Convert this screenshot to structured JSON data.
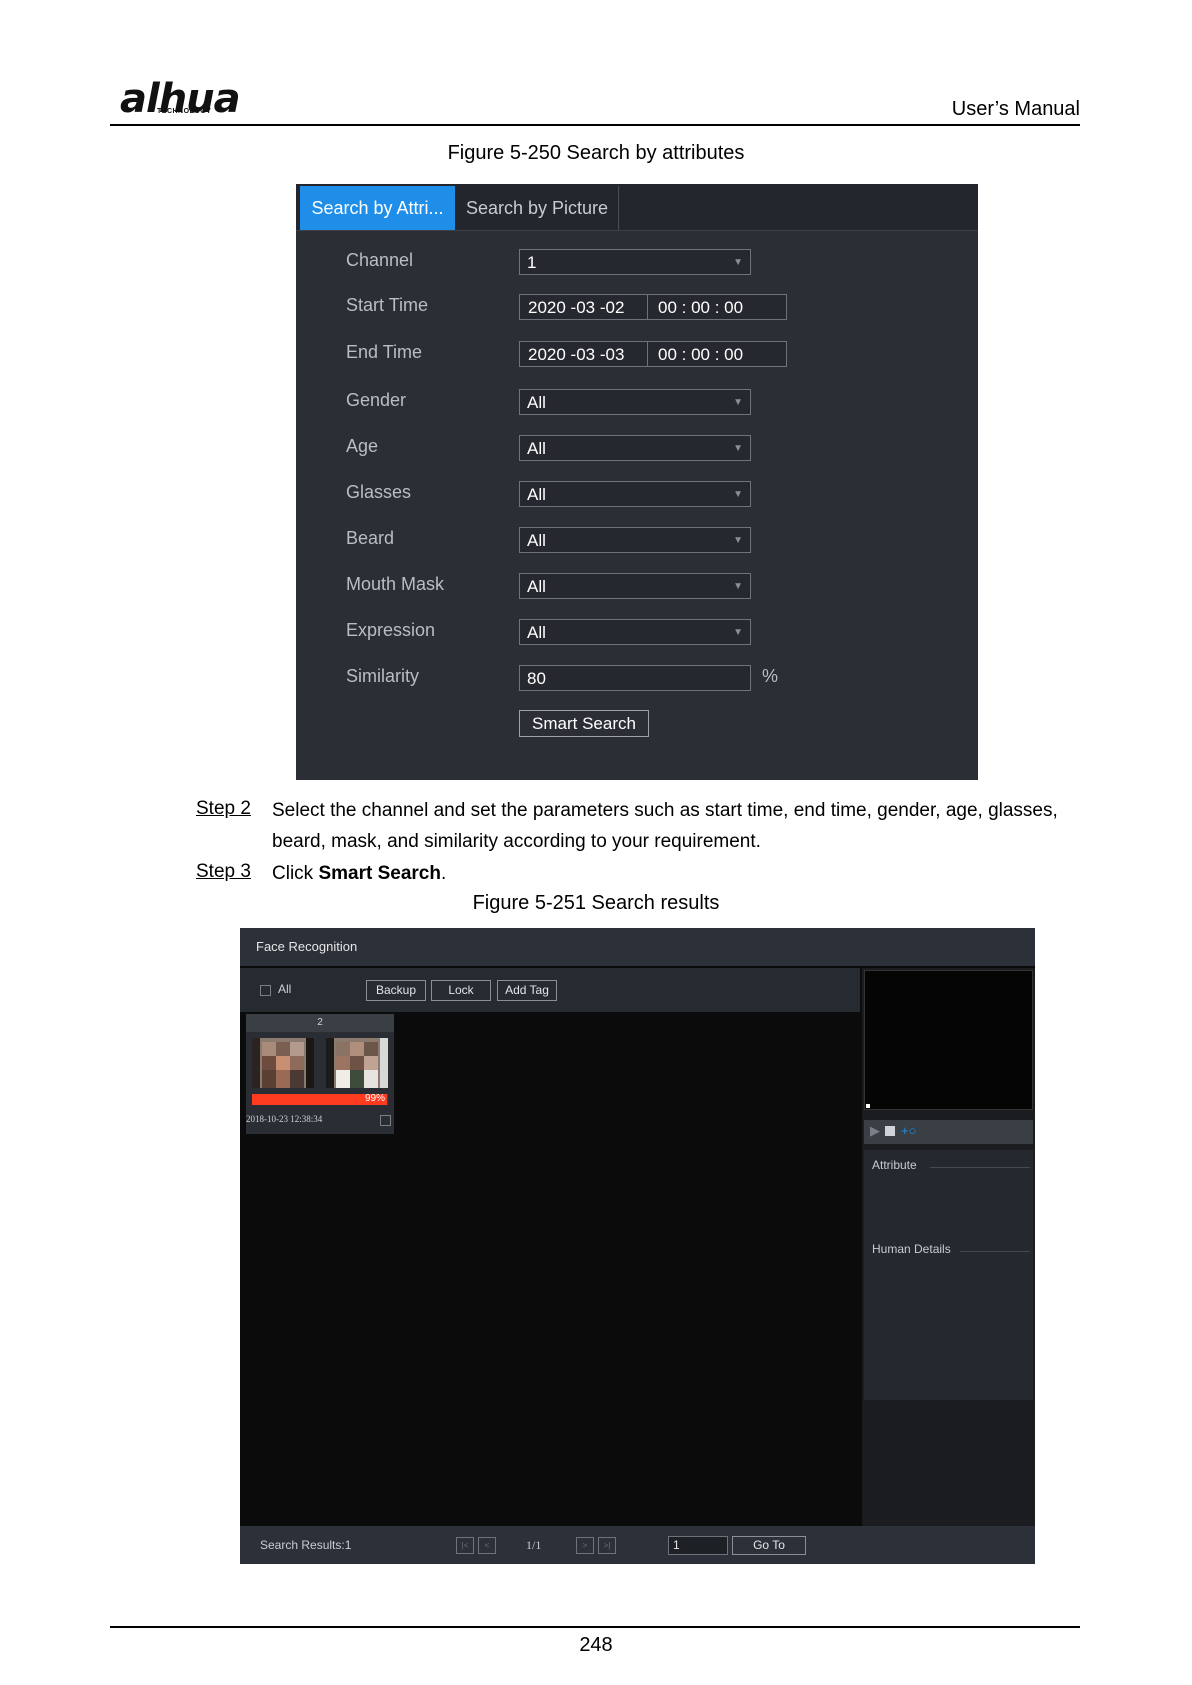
{
  "header": {
    "logo_text": "alhua",
    "logo_sub": "TECHNOLOGY",
    "manual_title": "User’s Manual"
  },
  "figure1": {
    "caption": "Figure 5-250 Search by attributes",
    "tabs": [
      {
        "label": "Search by Attri...",
        "active": true
      },
      {
        "label": "Search by Picture",
        "active": false
      }
    ],
    "fields": {
      "channel": {
        "label": "Channel",
        "value": "1"
      },
      "start_time": {
        "label": "Start Time",
        "date": "2020 -03 -02",
        "time": "00 : 00 : 00"
      },
      "end_time": {
        "label": "End Time",
        "date": "2020 -03 -03",
        "time": "00 : 00 : 00"
      },
      "gender": {
        "label": "Gender",
        "value": "All"
      },
      "age": {
        "label": "Age",
        "value": "All"
      },
      "glasses": {
        "label": "Glasses",
        "value": "All"
      },
      "beard": {
        "label": "Beard",
        "value": "All"
      },
      "mouth_mask": {
        "label": "Mouth Mask",
        "value": "All"
      },
      "expression": {
        "label": "Expression",
        "value": "All"
      },
      "similarity": {
        "label": "Similarity",
        "value": "80",
        "unit": "%"
      }
    },
    "smart_search_label": "Smart Search",
    "colors": {
      "accent": "#1e8ee8",
      "panel_bg": "#2b2e35"
    }
  },
  "steps": [
    {
      "label": "Step 2",
      "text": "Select the channel and set the parameters such as start time, end time, gender, age, glasses, beard, mask, and similarity according to your requirement."
    },
    {
      "label": "Step 3",
      "text_prefix": "Click ",
      "text_bold": "Smart Search",
      "text_suffix": "."
    }
  ],
  "figure2": {
    "caption": "Figure 5-251 Search results",
    "title": "Face Recognition",
    "toolbar": {
      "all_label": "All",
      "backup": "Backup",
      "lock": "Lock",
      "add_tag": "Add Tag"
    },
    "result_card": {
      "count": "2",
      "similarity": "99%",
      "similarity_fraction": 0.99,
      "timestamp": "2018-10-23 12:38:34"
    },
    "side_panel": {
      "attribute_label": "Attribute",
      "human_details_label": "Human Details"
    },
    "status": {
      "results": "Search Results:1",
      "page": "1/1",
      "goto_value": "1",
      "goto_label": "Go To"
    },
    "colors": {
      "similarity_bar": "#ff3b1f",
      "icon_blue": "#1e8ee8"
    }
  },
  "footer": {
    "page_number": "248"
  }
}
